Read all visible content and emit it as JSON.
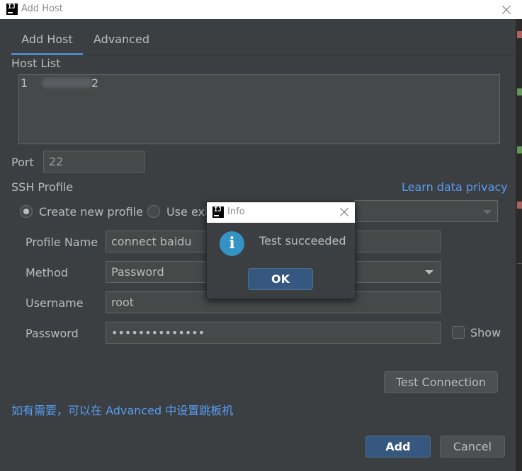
{
  "window": {
    "title": "Add Host"
  },
  "tabs": [
    {
      "label": "Add Host"
    },
    {
      "label": "Advanced"
    }
  ],
  "host_list": {
    "label": "Host List",
    "value_start": "1",
    "value_end": "2"
  },
  "port": {
    "label": "Port",
    "value": "22"
  },
  "ssh_profile": {
    "label": "SSH Profile",
    "learn_link": "Learn data privacy",
    "create_new_label": "Create new profile",
    "use_existing_label": "Use exis"
  },
  "form": {
    "profile_name_label": "Profile Name",
    "profile_name_value": "connect baidu",
    "method_label": "Method",
    "method_value": "Password",
    "username_label": "Username",
    "username_value": "root",
    "password_label": "Password",
    "password_value": "••••••••••••••",
    "show_label": "Show"
  },
  "buttons": {
    "test_connection": "Test Connection",
    "add": "Add",
    "cancel": "Cancel"
  },
  "advanced_hint": "如有需要，可以在 Advanced 中设置跳板机",
  "info_dialog": {
    "title": "Info",
    "message": "Test succeeded",
    "ok": "OK",
    "icon": "info-icon"
  },
  "app_logo": "IJ",
  "colors": {
    "accent": "#4a88c7",
    "link": "#589df6",
    "primary_button": "#365880",
    "info_icon": "#3592c4"
  }
}
